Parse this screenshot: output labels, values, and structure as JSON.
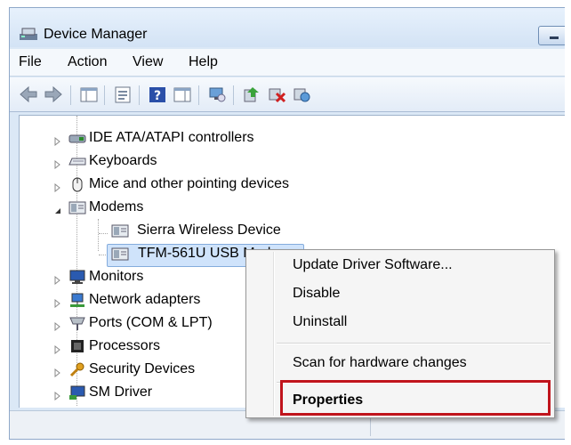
{
  "window": {
    "title": "Device Manager"
  },
  "menu": {
    "items": [
      "File",
      "Action",
      "View",
      "Help"
    ]
  },
  "toolbar": {
    "icons": [
      "back-arrow-icon",
      "forward-arrow-icon",
      "show-hide-console-tree-icon",
      "properties-icon",
      "help-icon",
      "action-pane-icon",
      "monitor-icon",
      "update-driver-icon",
      "uninstall-icon",
      "scan-hardware-icon"
    ]
  },
  "tree": {
    "items": [
      {
        "label": "IDE ATA/ATAPI controllers",
        "icon": "ide-controller-icon"
      },
      {
        "label": "Keyboards",
        "icon": "keyboard-icon"
      },
      {
        "label": "Mice and other pointing devices",
        "icon": "mouse-icon"
      },
      {
        "label": "Modems",
        "icon": "modem-icon",
        "expanded": true
      },
      {
        "label": "Sierra Wireless Device",
        "icon": "modem-icon",
        "child": true
      },
      {
        "label": "TFM-561U USB Modem",
        "icon": "modem-icon",
        "child": true,
        "selected": true
      },
      {
        "label": "Monitors",
        "icon": "monitor-icon"
      },
      {
        "label": "Network adapters",
        "icon": "network-adapter-icon"
      },
      {
        "label": "Ports (COM & LPT)",
        "icon": "port-icon"
      },
      {
        "label": "Processors",
        "icon": "processor-icon"
      },
      {
        "label": "Security Devices",
        "icon": "security-key-icon"
      },
      {
        "label": "SM Driver",
        "icon": "sm-driver-icon"
      }
    ]
  },
  "context_menu": {
    "items": [
      "Update Driver Software...",
      "Disable",
      "Uninstall",
      "Scan for hardware changes",
      "Properties"
    ]
  },
  "colors": {
    "highlight": "#c0141c",
    "selection": "#cfe3fb"
  }
}
